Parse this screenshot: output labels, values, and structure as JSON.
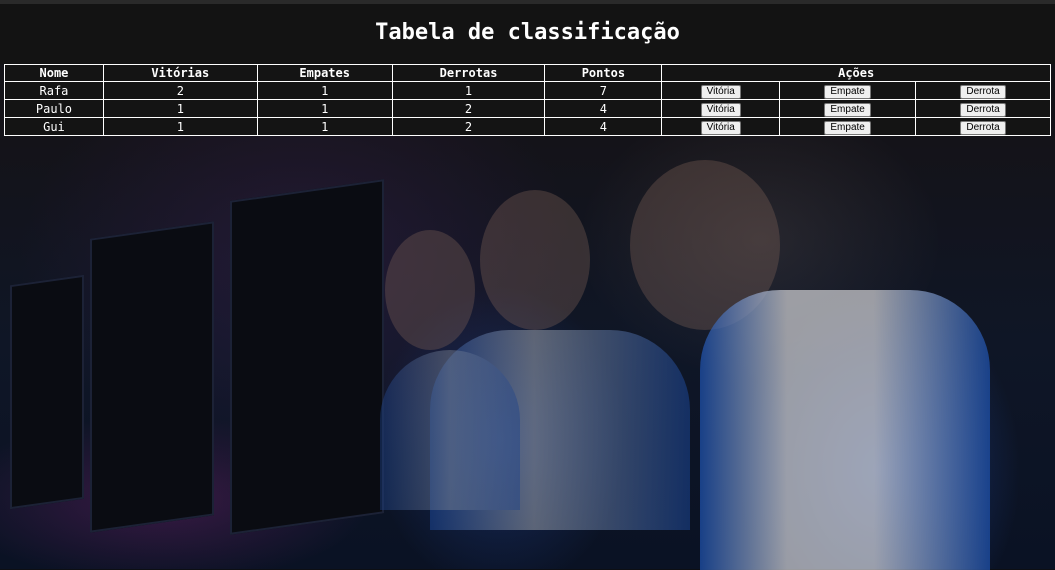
{
  "title": "Tabela de classificação",
  "table": {
    "headers": [
      "Nome",
      "Vitórias",
      "Empates",
      "Derrotas",
      "Pontos",
      "Ações"
    ],
    "rows": [
      {
        "nome": "Rafa",
        "vitorias": "2",
        "empates": "1",
        "derrotas": "1",
        "pontos": "7"
      },
      {
        "nome": "Paulo",
        "vitorias": "1",
        "empates": "1",
        "derrotas": "2",
        "pontos": "4"
      },
      {
        "nome": "Gui",
        "vitorias": "1",
        "empates": "1",
        "derrotas": "2",
        "pontos": "4"
      }
    ],
    "actions": {
      "win": "Vitória",
      "draw": "Empate",
      "loss": "Derrota"
    }
  }
}
